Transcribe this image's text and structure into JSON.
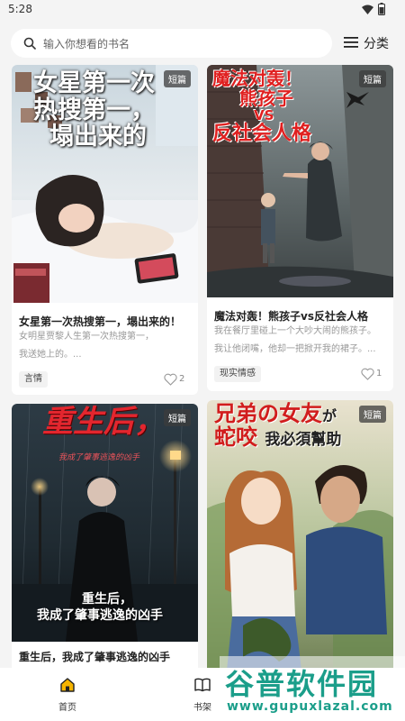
{
  "status": {
    "time": "5:28"
  },
  "search": {
    "placeholder": "输入你想看的书名"
  },
  "category": {
    "label": "分类"
  },
  "books": [
    {
      "cover_title": [
        "女星第一次",
        "热搜第一，",
        "塌出来的"
      ],
      "badge": "短篇",
      "title": "女星第一次热搜第一，塌出来的！",
      "desc": [
        "女明星贾黎人生第一次热搜第一，",
        "我送她上的。..."
      ],
      "tag": "言情",
      "likes": "2"
    },
    {
      "cover_title": [
        "魔法对轰！",
        "熊孩子",
        "VS",
        "反社会人格"
      ],
      "badge": "短篇",
      "title": "魔法对轰！熊孩子vs反社会人格",
      "desc": [
        "我在餐厅里碰上一个大吵大闹的熊孩子。",
        "我让他闭嘴，他却一把掀开我的裙子。..."
      ],
      "tag": "现实情感",
      "likes": "1"
    },
    {
      "cover_title": [
        "重生后，"
      ],
      "cover_subtitle": "我成了肇事逃逸的凶手",
      "cover_caption": [
        "重生后，",
        "我成了肇事逃逸的凶手"
      ],
      "badge": "短篇",
      "title": "重生后，我成了肇事逃逸的凶手"
    },
    {
      "cover_title": [
        "兄弟の女友",
        "が",
        "蛇咬",
        "我必須幫助"
      ],
      "badge": "短篇"
    }
  ],
  "tabbar": {
    "home": "首页",
    "shelf": "书架"
  },
  "watermark": {
    "main": "谷普软件园",
    "url": "www.gupuxlazal.com"
  },
  "colors": {
    "accent": "#f5b400",
    "background": "#f4f4f4",
    "card": "#ffffff"
  }
}
